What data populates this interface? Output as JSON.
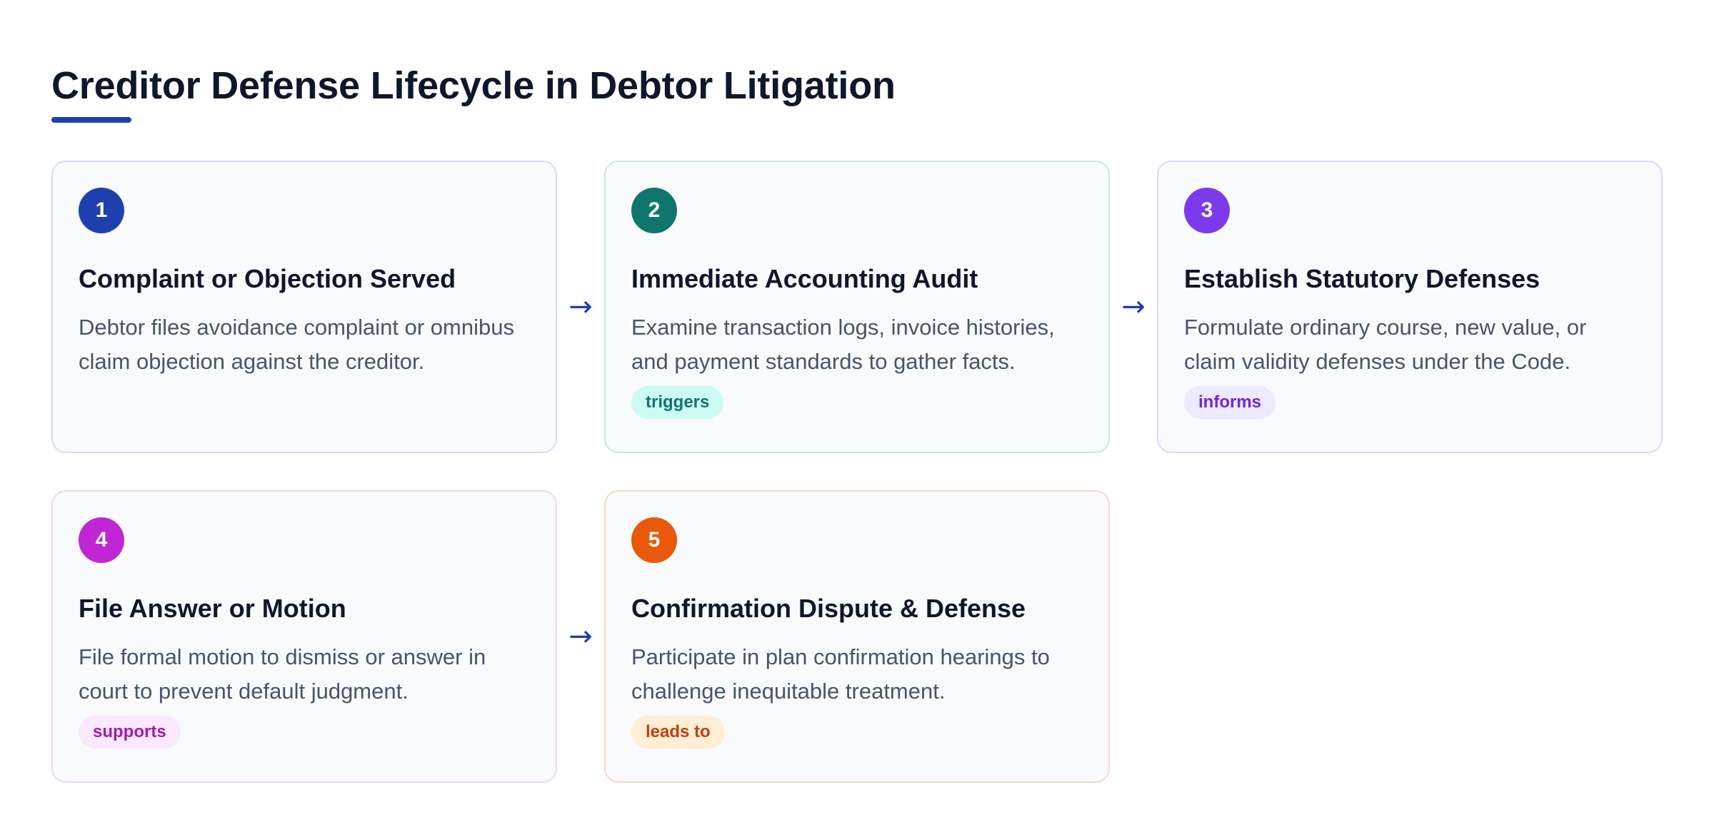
{
  "title": "Creditor Defense Lifecycle in Debtor Litigation",
  "colors": {
    "title_underline": "#1e40af",
    "connector": "#1e40af"
  },
  "steps": [
    {
      "number": "1",
      "title": "Complaint or Objection Served",
      "description": "Debtor files avoidance complaint or omnibus claim objection against the creditor.",
      "tag": "",
      "color": "#1e40af",
      "tag_bg": "",
      "tag_color": ""
    },
    {
      "number": "2",
      "title": "Immediate Accounting Audit",
      "description": "Examine transaction logs, invoice histories, and payment standards to gather facts.",
      "tag": "triggers",
      "color": "#0f766e",
      "tag_bg": "#ccfbf1",
      "tag_color": "#0f766e"
    },
    {
      "number": "3",
      "title": "Establish Statutory Defenses",
      "description": "Formulate ordinary course, new value, or claim validity defenses under the Code.",
      "tag": "informs",
      "color": "#7c3aed",
      "tag_bg": "#ede9fe",
      "tag_color": "#6d28d9"
    },
    {
      "number": "4",
      "title": "File Answer or Motion",
      "description": "File formal motion to dismiss or answer in court to prevent default judgment.",
      "tag": "supports",
      "color": "#c026d3",
      "tag_bg": "#fae8ff",
      "tag_color": "#a21caf"
    },
    {
      "number": "5",
      "title": "Confirmation Dispute & Defense",
      "description": "Participate in plan confirmation hearings to challenge inequitable treatment.",
      "tag": "leads to",
      "color": "#ea580c",
      "tag_bg": "#ffedd5",
      "tag_color": "#c2410c"
    }
  ],
  "connector_glyph": "→"
}
